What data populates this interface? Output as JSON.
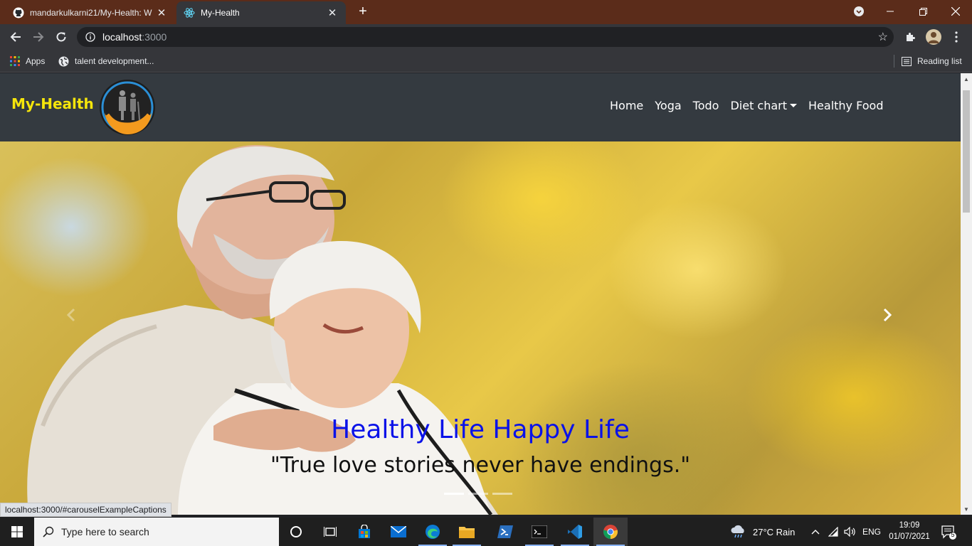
{
  "browser": {
    "tabs": [
      {
        "title": "mandarkulkarni21/My-Health: W",
        "icon": "github-icon"
      },
      {
        "title": "My-Health",
        "icon": "react-icon"
      }
    ],
    "url_host": "localhost",
    "url_port": ":3000",
    "bookmarks": [
      {
        "label": "Apps",
        "icon": "apps-grid-icon"
      },
      {
        "label": "talent development...",
        "icon": "globe-icon"
      }
    ],
    "reading_list": "Reading list",
    "status_link": "localhost:3000/#carouselExampleCaptions"
  },
  "site": {
    "brand": "My-Health",
    "nav": {
      "home": "Home",
      "yoga": "Yoga",
      "todo": "Todo",
      "diet_chart": "Diet chart",
      "healthy_food": "Healthy Food"
    },
    "carousel": {
      "title": "Healthy Life Happy Life",
      "quote": "\"True love stories never have endings.\"",
      "slide_count": 3,
      "active_slide": 1
    },
    "colors": {
      "navbar_bg": "#343a40",
      "brand": "#f5e50b",
      "caption_title": "#0a12e8",
      "caption_quote": "#111111"
    }
  },
  "taskbar": {
    "search_placeholder": "Type here to search",
    "weather": "27°C  Rain",
    "language": "ENG",
    "time": "19:09",
    "date": "01/07/2021",
    "notifications": "5"
  }
}
